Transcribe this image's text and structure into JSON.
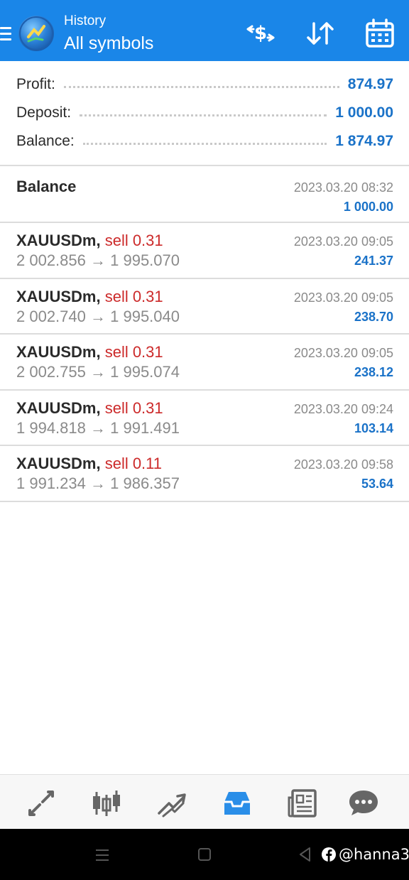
{
  "header": {
    "subtitle": "History",
    "title": "All symbols"
  },
  "summary": {
    "profit_label": "Profit:",
    "profit_value": "874.97",
    "deposit_label": "Deposit:",
    "deposit_value": "1 000.00",
    "balance_label": "Balance:",
    "balance_value": "1 874.97"
  },
  "balance_entry": {
    "title": "Balance",
    "time": "2023.03.20 08:32",
    "amount": "1 000.00"
  },
  "deals": [
    {
      "symbol": "XAUUSDm,",
      "side": "sell 0.31",
      "open": "2 002.856",
      "arrow": "→",
      "close": "1 995.070",
      "time": "2023.03.20 09:05",
      "profit": "241.37"
    },
    {
      "symbol": "XAUUSDm,",
      "side": "sell 0.31",
      "open": "2 002.740",
      "arrow": "→",
      "close": "1 995.040",
      "time": "2023.03.20 09:05",
      "profit": "238.70"
    },
    {
      "symbol": "XAUUSDm,",
      "side": "sell 0.31",
      "open": "2 002.755",
      "arrow": "→",
      "close": "1 995.074",
      "time": "2023.03.20 09:05",
      "profit": "238.12"
    },
    {
      "symbol": "XAUUSDm,",
      "side": "sell 0.31",
      "open": "1 994.818",
      "arrow": "→",
      "close": "1 991.491",
      "time": "2023.03.20 09:24",
      "profit": "103.14"
    },
    {
      "symbol": "XAUUSDm,",
      "side": "sell 0.11",
      "open": "1 991.234",
      "arrow": "→",
      "close": "1 986.357",
      "time": "2023.03.20 09:58",
      "profit": "53.64"
    }
  ],
  "toolbar_icons": [
    "menu-icon",
    "currency-exchange-icon",
    "sort-icon",
    "calendar-icon"
  ],
  "nav_icons": [
    "quotes-icon",
    "chart-icon",
    "trade-icon",
    "history-icon",
    "news-icon",
    "messages-icon"
  ],
  "nav_active": "history-icon",
  "watermark": {
    "text": "@hanna3"
  },
  "colors": {
    "header_bg": "#1a86e8",
    "accent": "#1a72c8",
    "sell": "#cc2a2a",
    "active_nav": "#2a8ee8"
  }
}
